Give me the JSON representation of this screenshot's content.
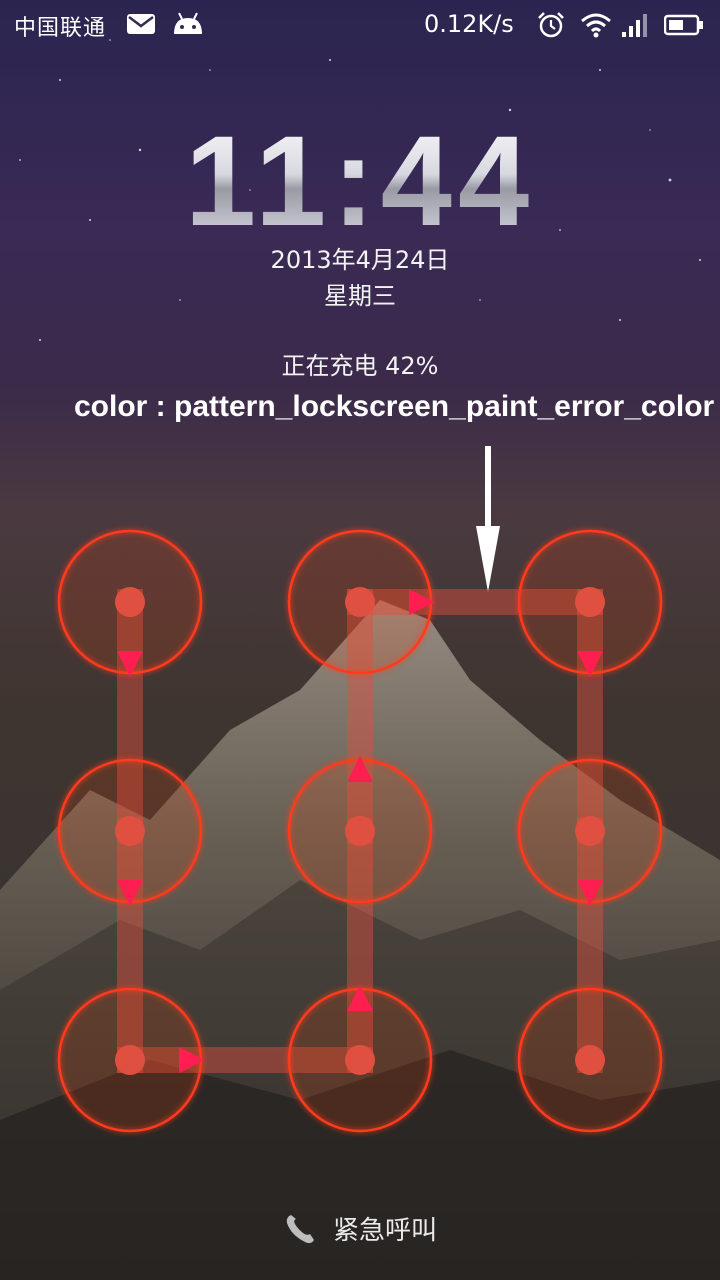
{
  "status_bar": {
    "carrier": "中国联通",
    "net_speed": "0.12K/s",
    "icons": [
      "mail-icon",
      "android-icon",
      "alarm-icon",
      "wifi-icon",
      "signal-icon",
      "battery-icon"
    ]
  },
  "lockscreen": {
    "time": "11:44",
    "date": "2013年4月24日",
    "weekday": "星期三",
    "charging_status": "正在充电 42%"
  },
  "annotation": {
    "label": "color : pattern_lockscreen_paint_error_color"
  },
  "pattern_lock": {
    "state": "error",
    "error_color": "#ff3b1e",
    "path_color": "#e05040",
    "arrow_color": "#ff1e50",
    "path": [
      1,
      4,
      7,
      8,
      5,
      2,
      3,
      6,
      9
    ]
  },
  "emergency_call": {
    "label": "紧急呼叫"
  }
}
